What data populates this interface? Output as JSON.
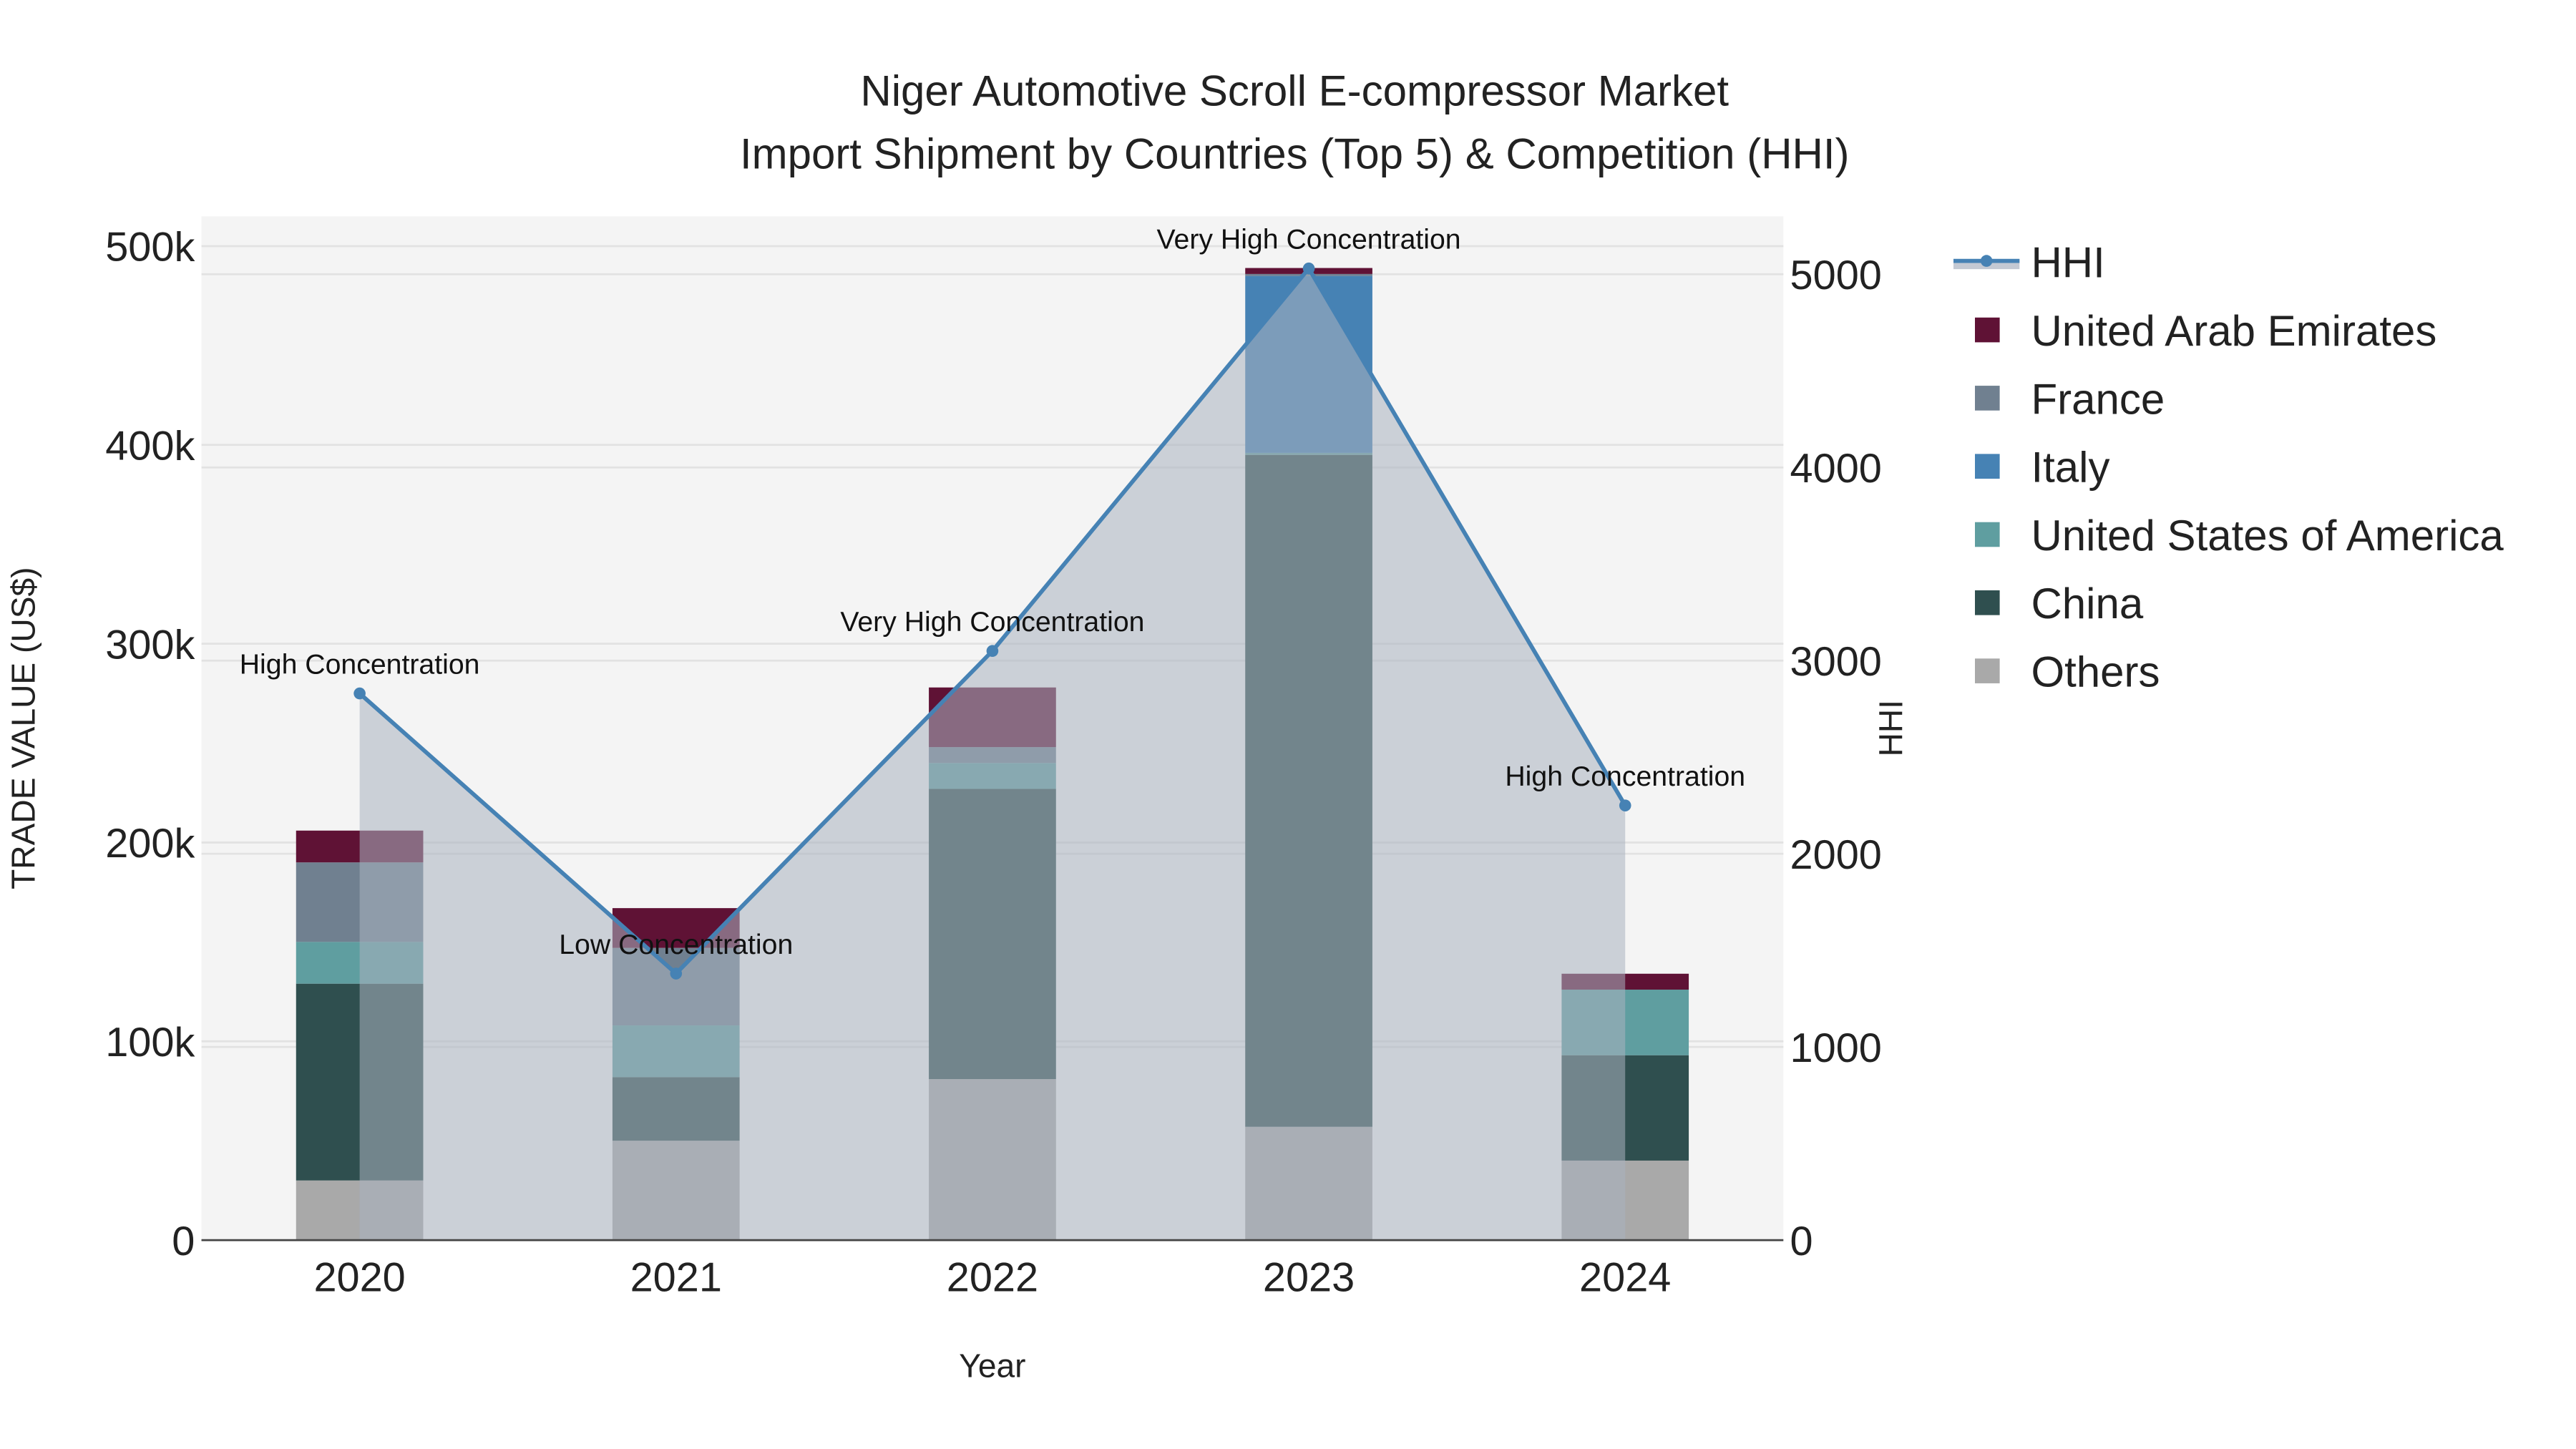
{
  "chart_data": {
    "type": "bar",
    "title": "Niger Automotive Scroll E-compressor Market",
    "subtitle": "Import Shipment by Countries (Top 5) & Competition (HHI)",
    "xlabel": "Year",
    "ylabel": "TRADE VALUE (US$)",
    "y2label": "HHI",
    "categories": [
      "2020",
      "2021",
      "2022",
      "2023",
      "2024"
    ],
    "ylim": [
      0,
      515000
    ],
    "y2lim": [
      0,
      5300
    ],
    "yticks": [
      0,
      100000,
      200000,
      300000,
      400000,
      500000
    ],
    "ytick_labels": [
      "0",
      "100k",
      "200k",
      "300k",
      "400k",
      "500k"
    ],
    "y2ticks": [
      0,
      1000,
      2000,
      3000,
      4000,
      5000
    ],
    "y2tick_labels": [
      "0",
      "1000",
      "2000",
      "3000",
      "4000",
      "5000"
    ],
    "stacked": true,
    "series": [
      {
        "name": "Others",
        "color": "#a9a9a9",
        "values": [
          30000,
          50000,
          81000,
          57000,
          40000
        ]
      },
      {
        "name": "China",
        "color": "#2f4f4f",
        "values": [
          99000,
          32000,
          146000,
          338000,
          53000
        ]
      },
      {
        "name": "United States of America",
        "color": "#5f9ea0",
        "values": [
          21000,
          26000,
          13000,
          1000,
          33000
        ]
      },
      {
        "name": "Italy",
        "color": "#4682b4",
        "values": [
          0,
          0,
          0,
          89000,
          0
        ]
      },
      {
        "name": "France",
        "color": "#708090",
        "values": [
          40000,
          39000,
          8000,
          1000,
          0
        ]
      },
      {
        "name": "United Arab Emirates",
        "color": "#5f1235",
        "values": [
          16000,
          20000,
          30000,
          3000,
          8000
        ]
      }
    ],
    "line": {
      "name": "HHI",
      "color": "#4682b4",
      "values": [
        2830,
        1380,
        3050,
        5030,
        2250
      ],
      "annotations": [
        "High Concentration",
        "Low Concentration",
        "Very High Concentration",
        "Very High Concentration",
        "High Concentration"
      ]
    },
    "legend_order": [
      "HHI",
      "United Arab Emirates",
      "France",
      "Italy",
      "United States of America",
      "China",
      "Others"
    ],
    "legend_position": "right",
    "grid": true
  }
}
